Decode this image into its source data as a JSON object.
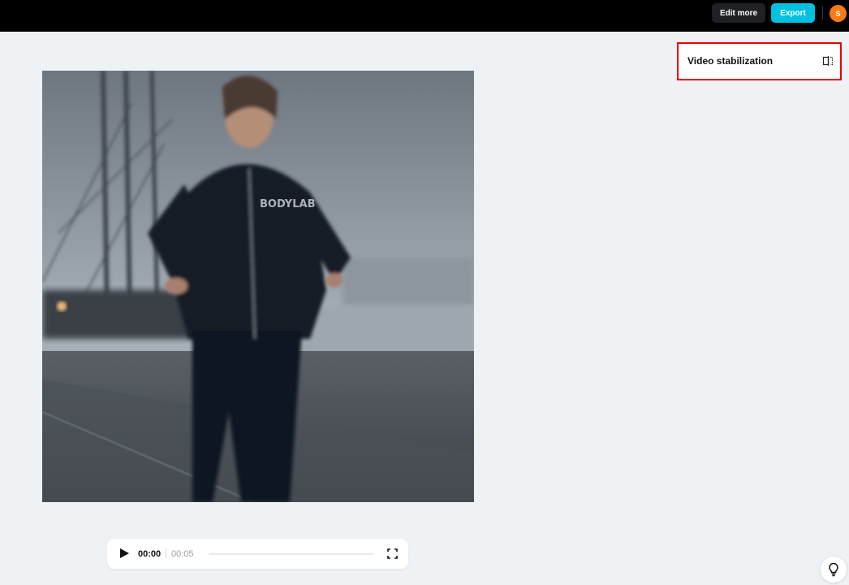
{
  "header": {
    "edit_more_label": "Edit more",
    "export_label": "Export",
    "avatar_initial": "S",
    "accent_color": "#00c2e0",
    "avatar_color": "#ff7a12"
  },
  "panel": {
    "title": "Video stabilization",
    "icon": "compare-split-icon"
  },
  "player": {
    "current_time": "00:00",
    "total_time": "00:05",
    "progress": 0,
    "play_icon": "play-icon",
    "fullscreen_icon": "fullscreen-icon"
  },
  "video": {
    "print_text": "BODYLAB"
  },
  "help": {
    "icon": "lightbulb-icon"
  }
}
